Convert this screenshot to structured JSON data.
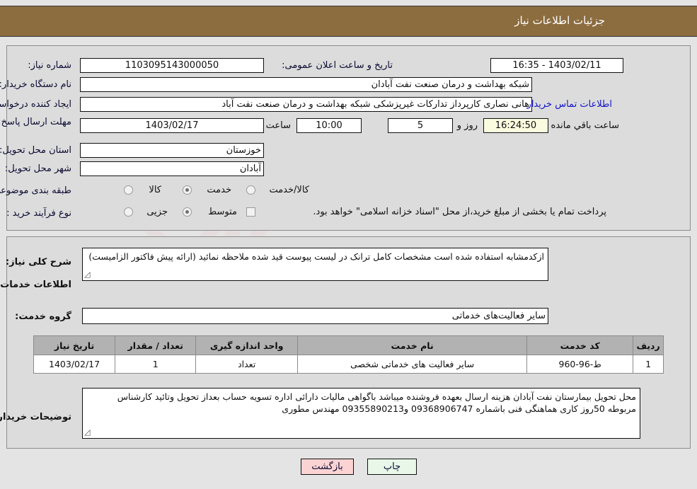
{
  "header": {
    "title": "جزئیات اطلاعات نیاز",
    "bar_color": "#8c6d3f"
  },
  "form": {
    "need_number_label": "شماره نیاز:",
    "need_number_value": "1103095143000050",
    "announce_datetime_label": "تاریخ و ساعت اعلان عمومی:",
    "announce_datetime_value": "1403/02/11 - 16:35",
    "buyer_org_label": "نام دستگاه خریدار:",
    "buyer_org_value": "شبکه بهداشت و درمان صنعت نفت آبادان",
    "creator_label": "ایجاد کننده درخواست:",
    "creator_value": "هانی نصاری کارپرداز تدارکات غیرپزشکی شبکه بهداشت و درمان صنعت نفت آباد",
    "contact_link": "اطلاعات تماس خریدار",
    "deadline_label": "مهلت ارسال پاسخ: تا تاریخ:",
    "deadline_date": "1403/02/17",
    "hour_label": "ساعت",
    "hour_value": "10:00",
    "days_value": "5",
    "days_and_label": "روز و",
    "remaining_value": "16:24:50",
    "remaining_label": "ساعت باقي مانده",
    "province_label": "استان محل تحویل:",
    "province_value": "خوزستان",
    "city_label": "شهر محل تحویل:",
    "city_value": "آبادان",
    "category_label": "طبقه بندی موضوعی:",
    "category_options": [
      "کالا",
      "خدمت",
      "کالا/خدمت"
    ],
    "category_selected": "خدمت",
    "purchase_type_label": "نوع فرآیند خرید :",
    "purchase_type_options": [
      "جزیی",
      "متوسط"
    ],
    "purchase_type_selected": "متوسط",
    "treasury_note": "پرداخت تمام یا بخشی از مبلغ خرید،از محل \"اسناد خزانه اسلامی\" خواهد بود.",
    "treasury_checked": false
  },
  "details": {
    "general_desc_label": "شرح کلی نیاز:",
    "general_desc_value": "ازکدمشابه استفاده شده است مشخصات کامل ترانک در لیست پیوست قید شده ملاحظه نمائید (ارائه پیش فاکتور الزامیست)",
    "services_section_title": "اطلاعات خدمات مورد نیاز",
    "service_group_label": "گروه خدمت:",
    "service_group_value": "سایر فعالیت‌های خدماتی"
  },
  "table": {
    "columns": [
      "ردیف",
      "کد خدمت",
      "نام خدمت",
      "واحد اندازه گیری",
      "تعداد / مقدار",
      "تاریخ نیاز"
    ],
    "rows": [
      {
        "row": "1",
        "service_code": "ط-96-960",
        "service_name": "سایر فعالیت های خدماتی شخصی",
        "unit": "تعداد",
        "quantity": "1",
        "need_date": "1403/02/17"
      }
    ]
  },
  "buyer_notes": {
    "label": "توضیحات خریدار:",
    "value": "محل تحویل بیمارستان نفت آبادان هزینه ارسال بعهده فروشنده میباشد باگواهی مالیات دارائی اداره تسویه حساب بعداز تحویل وتائید کارشناس مربوطه 50روز کاری هماهنگی فنی باشماره 09368906747 و09355890213 مهندس مطوری"
  },
  "footer": {
    "print_label": "چاپ",
    "back_label": "بازگشت"
  },
  "watermark": {
    "text": "AriaTender.net"
  }
}
